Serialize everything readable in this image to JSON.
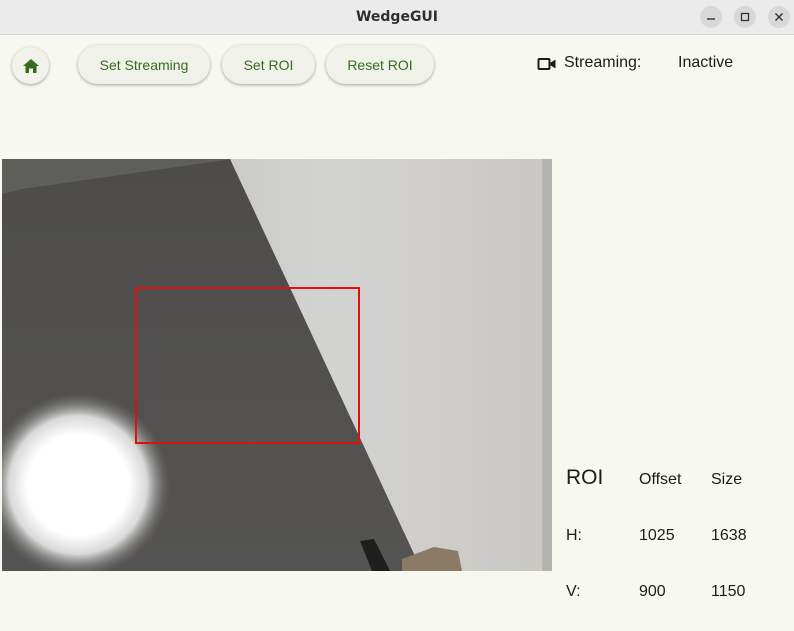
{
  "window": {
    "title": "WedgeGUI",
    "controls": [
      "minimize-icon",
      "maximize-icon",
      "close-icon"
    ]
  },
  "toolbar": {
    "home_icon": "home-icon",
    "set_streaming_label": "Set Streaming",
    "set_roi_label": "Set ROI",
    "reset_roi_label": "Reset ROI",
    "accent_color": "#386a20"
  },
  "status": {
    "icon": "video-camera-icon",
    "label": "Streaming:",
    "value": "Inactive"
  },
  "video": {
    "roi_overlay_color": "#e01010"
  },
  "roi": {
    "title": "ROI",
    "col_offset": "Offset",
    "col_size": "Size",
    "rows": [
      {
        "label": "H:",
        "offset": "1025",
        "size": "1638"
      },
      {
        "label": "V:",
        "offset": "900",
        "size": "1150"
      }
    ]
  }
}
